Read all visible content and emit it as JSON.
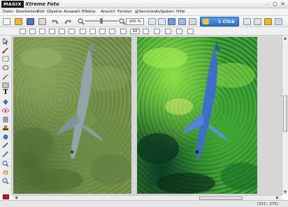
{
  "app": {
    "logo": "MAGIX",
    "title": "Xtreme Foto",
    "window_buttons": [
      "–",
      "▢",
      "✕"
    ]
  },
  "menu": [
    "Datei",
    "Bearbeiten",
    "Bild",
    "Objekte",
    "Auswahl",
    "Effekte",
    "Ansicht",
    "Fenster",
    "@Services",
    "Aufgaben",
    "Hilfe"
  ],
  "toolbar": {
    "zoom_value": "100 %",
    "one_click_label": "1 Click",
    "size_value": "10"
  },
  "status": {
    "coordinates": "(323 ; 375)"
  },
  "colors": {
    "active_color": "#c8102e",
    "one_click_bg": "#2a6cc2"
  },
  "icons": {
    "toolbar1": [
      "new-file-icon",
      "open-folder-icon",
      "save-icon",
      "print-icon",
      "undo-icon",
      "redo-icon",
      "zoom-out-icon",
      "zoom-in-icon",
      "one-click-icon",
      "gallery-icon",
      "layers-icon",
      "settings-icon"
    ],
    "tools": [
      "pointer-icon",
      "brush-icon",
      "selection-icon",
      "lasso-icon",
      "crop-icon",
      "text-icon",
      "fill-icon",
      "eye-icon",
      "stamp-icon",
      "shape-icon",
      "pen-icon",
      "picker-icon",
      "magnify-icon"
    ]
  }
}
